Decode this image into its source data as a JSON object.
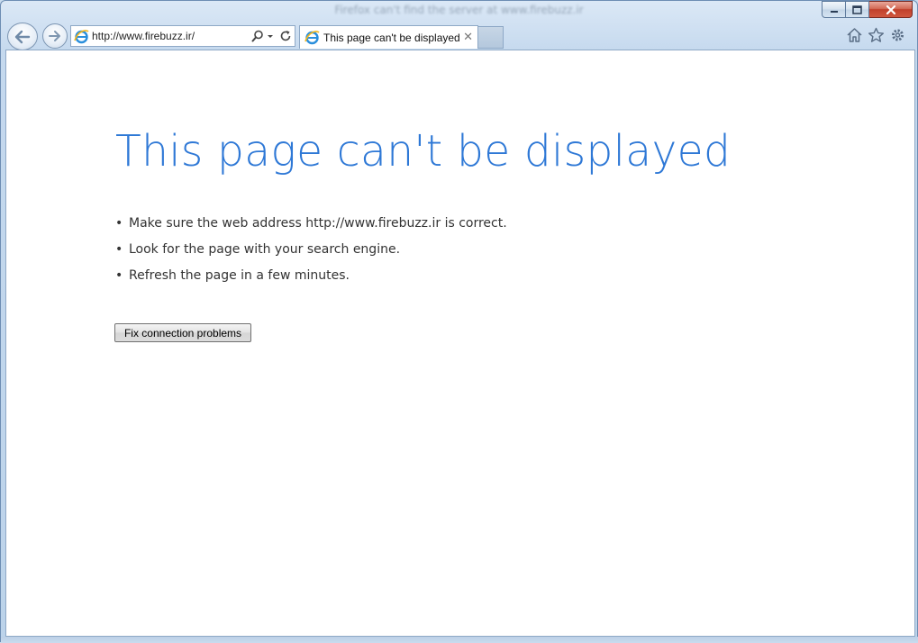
{
  "window": {
    "title": "Firefox can't find the server at www.firebuzz.ir",
    "caption_buttons": [
      "minimize-icon",
      "maximize-icon",
      "close-icon"
    ]
  },
  "navigation": {
    "back_icon": "arrow-left-icon",
    "forward_icon": "arrow-right-icon"
  },
  "address_bar": {
    "url": "http://www.firebuzz.ir/",
    "site_icon": "ie-logo-icon",
    "search_icon": "search-icon",
    "dropdown_icon": "chevron-down-icon",
    "refresh_icon": "refresh-icon"
  },
  "tabs": [
    {
      "label": "This page can't be displayed",
      "close_glyph": "✕",
      "active": true
    }
  ],
  "toolbar": {
    "icons": [
      "home-icon",
      "favorites-star-icon",
      "settings-gear-icon"
    ]
  },
  "page": {
    "title": "This page can't be displayed",
    "bullet_glyph": "•",
    "tips": [
      "Make sure the web address http://www.firebuzz.ir is correct.",
      "Look for the page with your search engine.",
      "Refresh the page in a few minutes."
    ],
    "fix_button_label": "Fix connection problems"
  },
  "colors": {
    "title_blue": "#2e78d6",
    "frame_blue": "#bcd3ea",
    "close_red": "#c0402b"
  }
}
